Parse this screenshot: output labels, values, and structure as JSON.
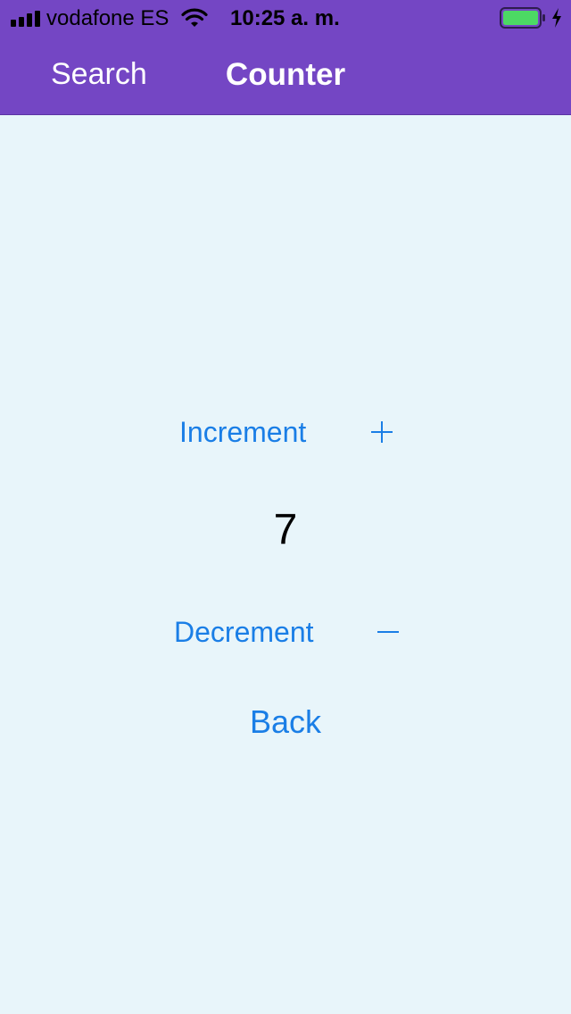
{
  "status_bar": {
    "carrier": "vodafone ES",
    "time": "10:25 a. m.",
    "battery_color": "#4cd964",
    "signal_icon": "signal-bars-icon",
    "wifi_icon": "wifi-icon",
    "charging_icon": "charging-bolt-icon"
  },
  "nav": {
    "back_label": "Search",
    "title": "Counter",
    "background": "#7446c4"
  },
  "counter": {
    "increment_label": "Increment",
    "increment_icon": "plus-icon",
    "value": "7",
    "decrement_label": "Decrement",
    "decrement_icon": "minus-icon",
    "back_label": "Back",
    "accent": "#1a7ee6"
  }
}
